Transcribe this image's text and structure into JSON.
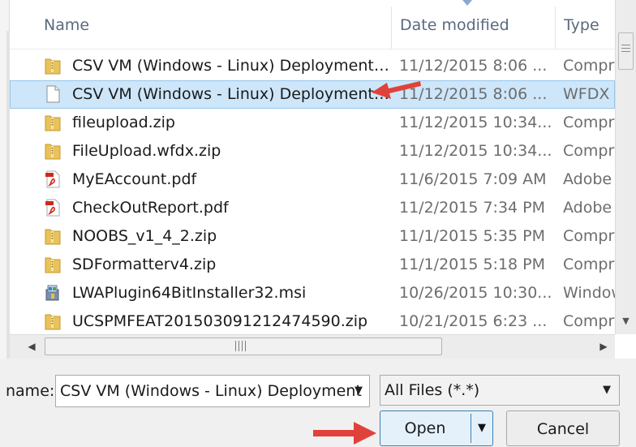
{
  "columns": {
    "name": "Name",
    "date_modified": "Date modified",
    "type": "Type"
  },
  "files": [
    {
      "icon": "folder-zip-icon",
      "name": "CSV VM (Windows - Linux) Deployment.z...",
      "date": "11/12/2015 8:06 ...",
      "type": "Compre"
    },
    {
      "icon": "blank-file-icon",
      "name": "CSV VM (Windows - Linux) Deployment....",
      "date": "11/12/2015 8:06 ...",
      "type": "WFDX F",
      "selected": true
    },
    {
      "icon": "folder-zip-icon",
      "name": "fileupload.zip",
      "date": "11/12/2015 10:34...",
      "type": "Compre"
    },
    {
      "icon": "folder-zip-icon",
      "name": "FileUpload.wfdx.zip",
      "date": "11/12/2015 10:34...",
      "type": "Compre"
    },
    {
      "icon": "pdf-icon",
      "name": "MyEAccount.pdf",
      "date": "11/6/2015 7:09 AM",
      "type": "Adobe"
    },
    {
      "icon": "pdf-icon",
      "name": "CheckOutReport.pdf",
      "date": "11/2/2015 7:34 PM",
      "type": "Adobe"
    },
    {
      "icon": "folder-zip-icon",
      "name": "NOOBS_v1_4_2.zip",
      "date": "11/1/2015 5:35 PM",
      "type": "Compre"
    },
    {
      "icon": "folder-zip-icon",
      "name": "SDFormatterv4.zip",
      "date": "11/1/2015 5:18 PM",
      "type": "Compre"
    },
    {
      "icon": "installer-icon",
      "name": "LWAPlugin64BitInstaller32.msi",
      "date": "10/26/2015 10:30...",
      "type": "Window"
    },
    {
      "icon": "folder-zip-icon",
      "name": "UCSPMFEAT201503091212474590.zip",
      "date": "10/21/2015 6:23 ...",
      "type": "Compre"
    }
  ],
  "bottom": {
    "name_label": "name:",
    "file_name_value": "CSV VM (Windows - Linux) Deployment",
    "file_type_value": "All Files (*.*)",
    "open_label": "Open",
    "cancel_label": "Cancel"
  },
  "colors": {
    "selection": "#cde6f9",
    "annotation_arrow": "#e0413a",
    "open_button_border": "#3c7fb1"
  }
}
